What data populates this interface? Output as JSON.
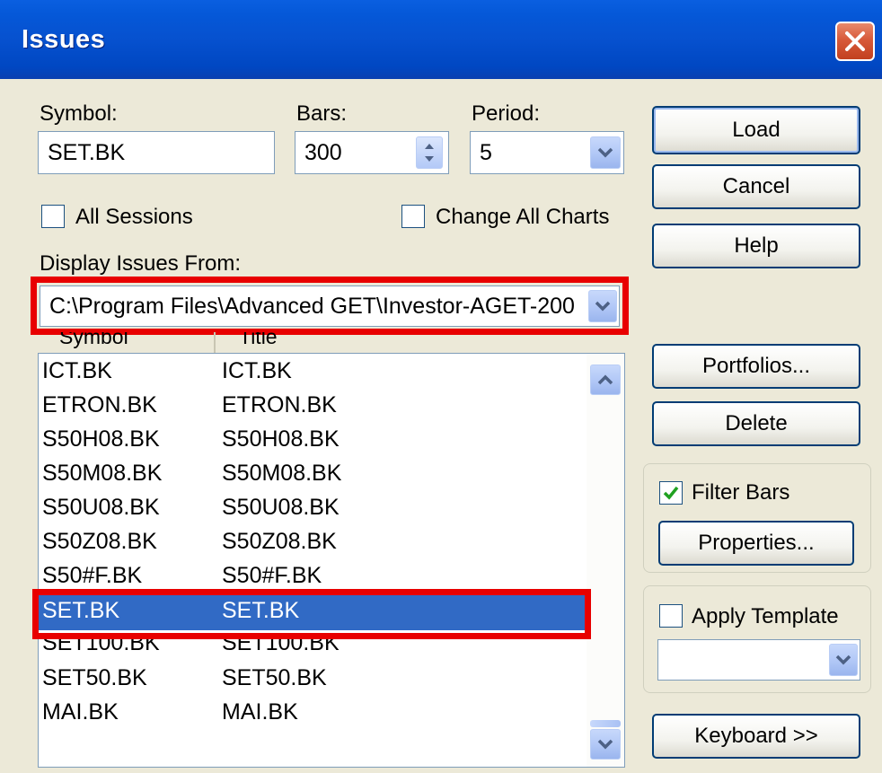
{
  "window": {
    "title": "Issues"
  },
  "form": {
    "symbol_label": "Symbol:",
    "symbol_value": "SET.BK",
    "bars_label": "Bars:",
    "bars_value": "300",
    "period_label": "Period:",
    "period_value": "5",
    "all_sessions_label": "All Sessions",
    "all_sessions_checked": false,
    "change_all_charts_label": "Change All Charts",
    "change_all_charts_checked": false,
    "display_from_label": "Display Issues From:",
    "display_from_value": "C:\\Program Files\\Advanced GET\\Investor-AGET-200"
  },
  "list": {
    "columns": [
      "Symbol",
      "Title"
    ],
    "rows": [
      {
        "symbol": "ICT.BK",
        "title": "ICT.BK"
      },
      {
        "symbol": "ETRON.BK",
        "title": "ETRON.BK"
      },
      {
        "symbol": "S50H08.BK",
        "title": "S50H08.BK"
      },
      {
        "symbol": "S50M08.BK",
        "title": "S50M08.BK"
      },
      {
        "symbol": "S50U08.BK",
        "title": "S50U08.BK"
      },
      {
        "symbol": "S50Z08.BK",
        "title": "S50Z08.BK"
      },
      {
        "symbol": "S50#F.BK",
        "title": "S50#F.BK"
      },
      {
        "symbol": "SET.BK",
        "title": "SET.BK"
      },
      {
        "symbol": "SET100.BK",
        "title": "SET100.BK"
      },
      {
        "symbol": "SET50.BK",
        "title": "SET50.BK"
      },
      {
        "symbol": "MAI.BK",
        "title": "MAI.BK"
      }
    ],
    "selected_symbol": "SET.BK"
  },
  "buttons": {
    "load": "Load",
    "cancel": "Cancel",
    "help": "Help",
    "portfolios": "Portfolios...",
    "delete": "Delete",
    "properties": "Properties...",
    "keyboard": "Keyboard >>"
  },
  "options": {
    "filter_bars_label": "Filter Bars",
    "filter_bars_checked": true,
    "apply_template_label": "Apply Template",
    "apply_template_checked": false,
    "template_value": ""
  },
  "highlight_color": "#e80000",
  "selection_color": "#316ac5",
  "titlebar_color": "#0558d8"
}
